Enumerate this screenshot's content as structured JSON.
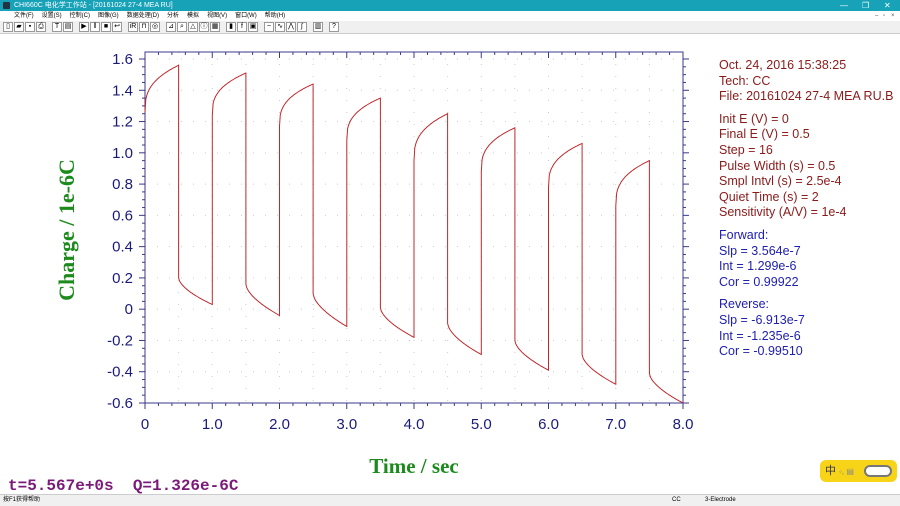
{
  "window": {
    "title": "CHI660C 电化学工作站 - [20161024 27-4 MEA RU]",
    "minimize": "—",
    "maximize": "❐",
    "close": "✕"
  },
  "menu": [
    "文件(F)",
    "设置(S)",
    "控制(C)",
    "图像(G)",
    "数据处理(D)",
    "分析",
    "模拟",
    "视图(V)",
    "窗口(W)",
    "帮助(H)"
  ],
  "toolbar": [
    "new-icon",
    "open-icon",
    "save-icon",
    "print-icon",
    "technique-icon",
    "parameters-icon",
    "run-icon",
    "pause-icon",
    "stop-icon",
    "reverse-icon",
    "ir-comp-icon",
    "filter-icon",
    "cell-icon",
    "zoom-icon",
    "magnify-icon",
    "warn-icon",
    "info-icon",
    "graph-options-icon",
    "color-icon",
    "font-icon",
    "copy-icon",
    "smooth-icon",
    "derivative-icon",
    "peak-icon",
    "integrate-icon",
    "calculator-icon",
    "help-icon"
  ],
  "chart_data": {
    "type": "line",
    "title": "",
    "xlabel": "Time / sec",
    "ylabel": "Charge / 1e-6C",
    "xlim": [
      0,
      8
    ],
    "ylim": [
      -0.6,
      1.6
    ],
    "xticks": [
      "0",
      "1.0",
      "2.0",
      "3.0",
      "4.0",
      "5.0",
      "6.0",
      "7.0",
      "8.0"
    ],
    "yticks": [
      "1.6",
      "1.4",
      "1.2",
      "1.0",
      "0.8",
      "0.6",
      "0.4",
      "0.2",
      "0",
      "-0.2",
      "-0.4",
      "-0.6"
    ],
    "grid": true,
    "color": "#c0282c",
    "pulse_width": 0.5,
    "pulses": [
      {
        "t": 0,
        "fwd_start": 1.26,
        "fwd_peak": 1.56,
        "rev_start": 0.2,
        "rev_end": 0.03
      },
      {
        "t": 1,
        "fwd_start": 1.24,
        "fwd_peak": 1.51,
        "rev_start": 0.16,
        "rev_end": -0.04
      },
      {
        "t": 2,
        "fwd_start": 1.17,
        "fwd_peak": 1.44,
        "rev_start": 0.1,
        "rev_end": -0.11
      },
      {
        "t": 3,
        "fwd_start": 1.08,
        "fwd_peak": 1.35,
        "rev_start": 0.01,
        "rev_end": -0.18
      },
      {
        "t": 4,
        "fwd_start": 0.95,
        "fwd_peak": 1.25,
        "rev_start": -0.09,
        "rev_end": -0.29
      },
      {
        "t": 5,
        "fwd_start": 0.88,
        "fwd_peak": 1.16,
        "rev_start": -0.2,
        "rev_end": -0.39
      },
      {
        "t": 6,
        "fwd_start": 0.78,
        "fwd_peak": 1.06,
        "rev_start": -0.29,
        "rev_end": -0.48
      },
      {
        "t": 7,
        "fwd_start": 0.66,
        "fwd_peak": 0.95,
        "rev_start": -0.41,
        "rev_end": -0.6
      }
    ]
  },
  "readout": "t=5.567e+0s  Q=1.326e-6C",
  "info": {
    "header": [
      "Oct. 24, 2016   15:38:25",
      "Tech: CC",
      "File: 20161024 27-4 MEA RU.B"
    ],
    "params": [
      "Init E (V) = 0",
      "Final E (V) = 0.5",
      "Step = 16",
      "Pulse Width (s) = 0.5",
      "Smpl Intvl (s) = 2.5e-4",
      "Quiet Time (s) = 2",
      "Sensitivity (A/V) = 1e-4"
    ],
    "forward": [
      "Forward:",
      "Slp = 3.564e-7",
      "Int = 1.299e-6",
      "Cor = 0.99922"
    ],
    "reverse": [
      "Reverse:",
      "Slp = -6.913e-7",
      "Int = -1.235e-6",
      "Cor = -0.99510"
    ]
  },
  "ime": {
    "label": "中"
  },
  "status": {
    "help": "按F1获得帮助",
    "tech": "CC",
    "electrode": "3-Electrode"
  }
}
